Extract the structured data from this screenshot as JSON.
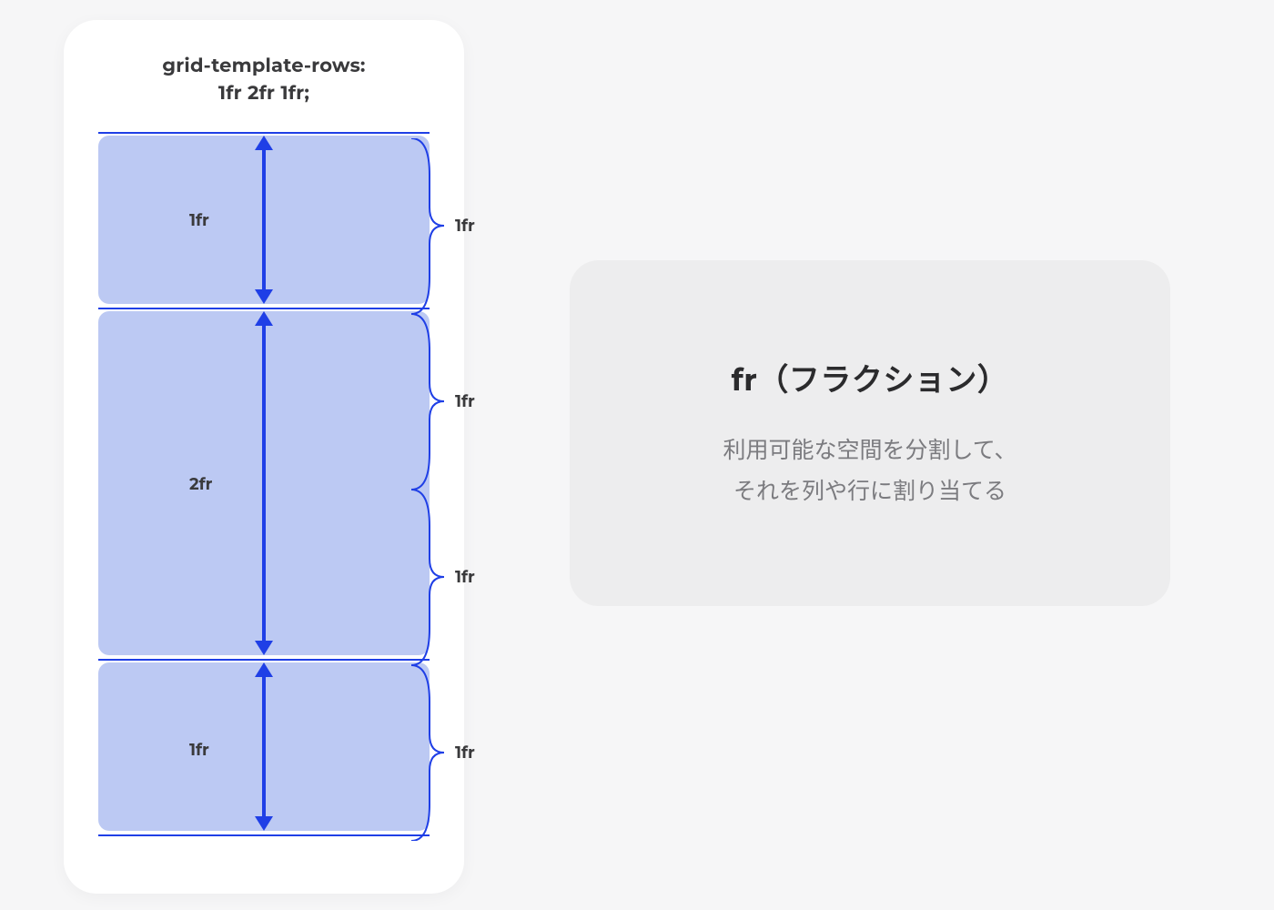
{
  "heading": {
    "line1": "grid-template-rows:",
    "line2": "1fr 2fr 1fr;"
  },
  "rows": {
    "r1": "1fr",
    "r2": "2fr",
    "r3": "1fr"
  },
  "fractions": {
    "f1": "1fr",
    "f2": "1fr",
    "f3": "1fr",
    "f4": "1fr"
  },
  "info": {
    "title": "fr（フラクション）",
    "body_line1": "利用可能な空間を分割して、",
    "body_line2": "それを列や行に割り当てる"
  },
  "colors": {
    "accent": "#1f3fe6",
    "fill": "#bcc9f3",
    "card": "#ededee"
  }
}
